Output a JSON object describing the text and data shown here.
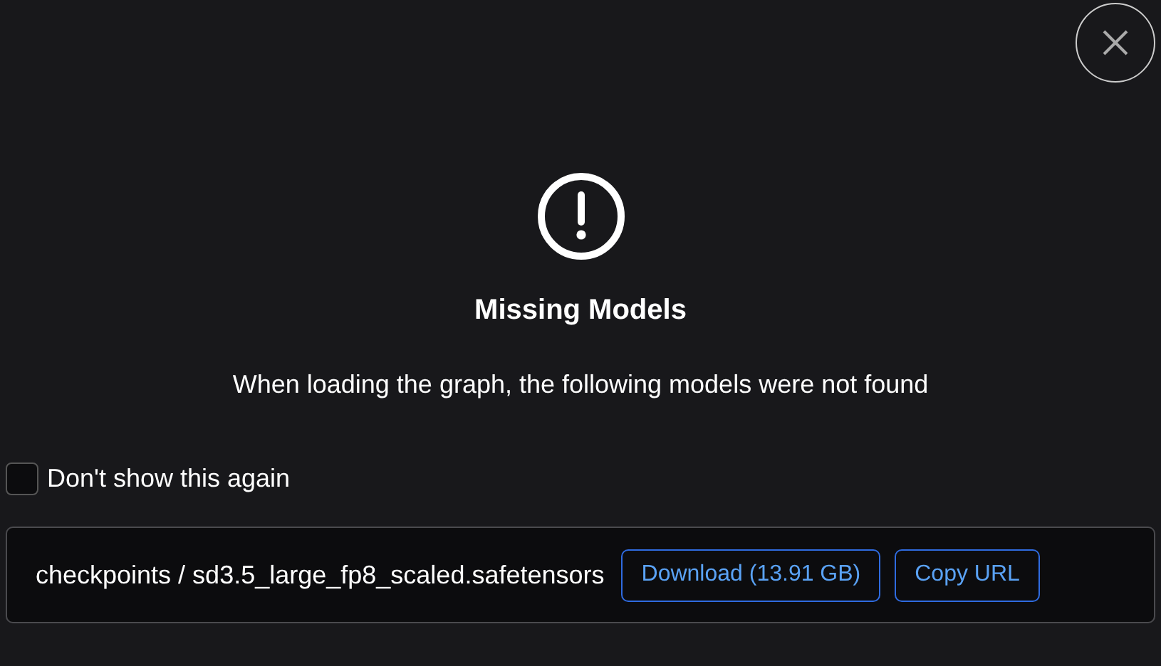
{
  "dialog": {
    "title": "Missing Models",
    "message": "When loading the graph, the following models were not found"
  },
  "dont_show_again": {
    "label": "Don't show this again",
    "checked": false
  },
  "models": [
    {
      "path": "checkpoints / sd3.5_large_fp8_scaled.safetensors",
      "download_label": "Download (13.91 GB)",
      "copy_label": "Copy URL"
    }
  ]
}
